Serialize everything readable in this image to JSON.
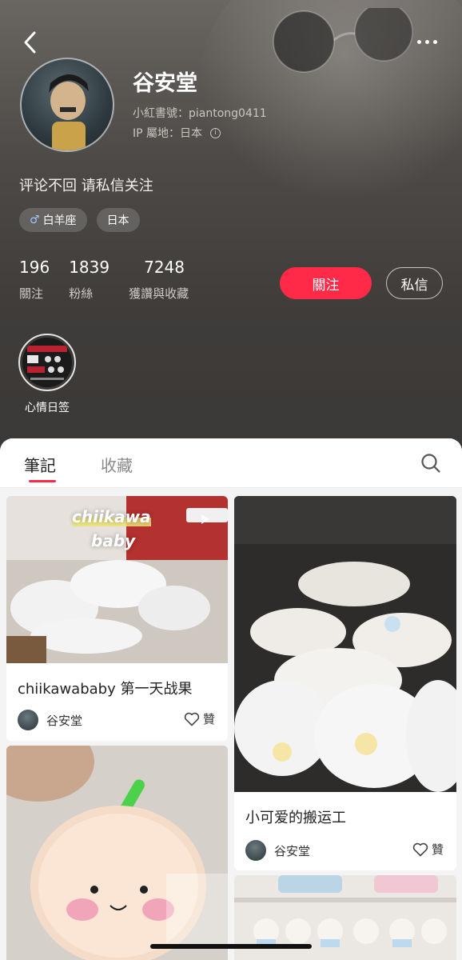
{
  "nav": {
    "back_icon": "chevron-left-icon",
    "more_icon": "more-dots-icon"
  },
  "profile": {
    "nickname": "谷安堂",
    "red_id": "小紅書號：piantong0411",
    "ip_location": "IP 屬地：日本",
    "bio": "评论不回 请私信关注",
    "tags": [
      {
        "icon": "♂",
        "label": "白羊座"
      },
      {
        "label": "日本"
      }
    ],
    "stats": [
      {
        "value": "196",
        "label": "關注"
      },
      {
        "value": "1839",
        "label": "粉絲"
      },
      {
        "value": "7248",
        "label": "獲讚與收藏"
      }
    ],
    "follow_label": "關注",
    "message_label": "私信",
    "highlight_label": "心情日签"
  },
  "tabs": {
    "notes": "筆記",
    "collections": "收藏",
    "search_icon": "search-icon"
  },
  "notes": [
    {
      "cover_text_1": "chiikawa",
      "cover_text_2": "baby",
      "title": "chiikawababy 第一天战果",
      "author": "谷安堂",
      "like_label": "贊"
    },
    {
      "title": "小可爱的搬运工",
      "author": "谷安堂",
      "like_label": "贊"
    },
    {
      "title": ""
    },
    {
      "title": ""
    }
  ],
  "colors": {
    "accent": "#ff2a47",
    "header_bg": "#3c3a38",
    "panel_bg": "#f4f4f4"
  }
}
